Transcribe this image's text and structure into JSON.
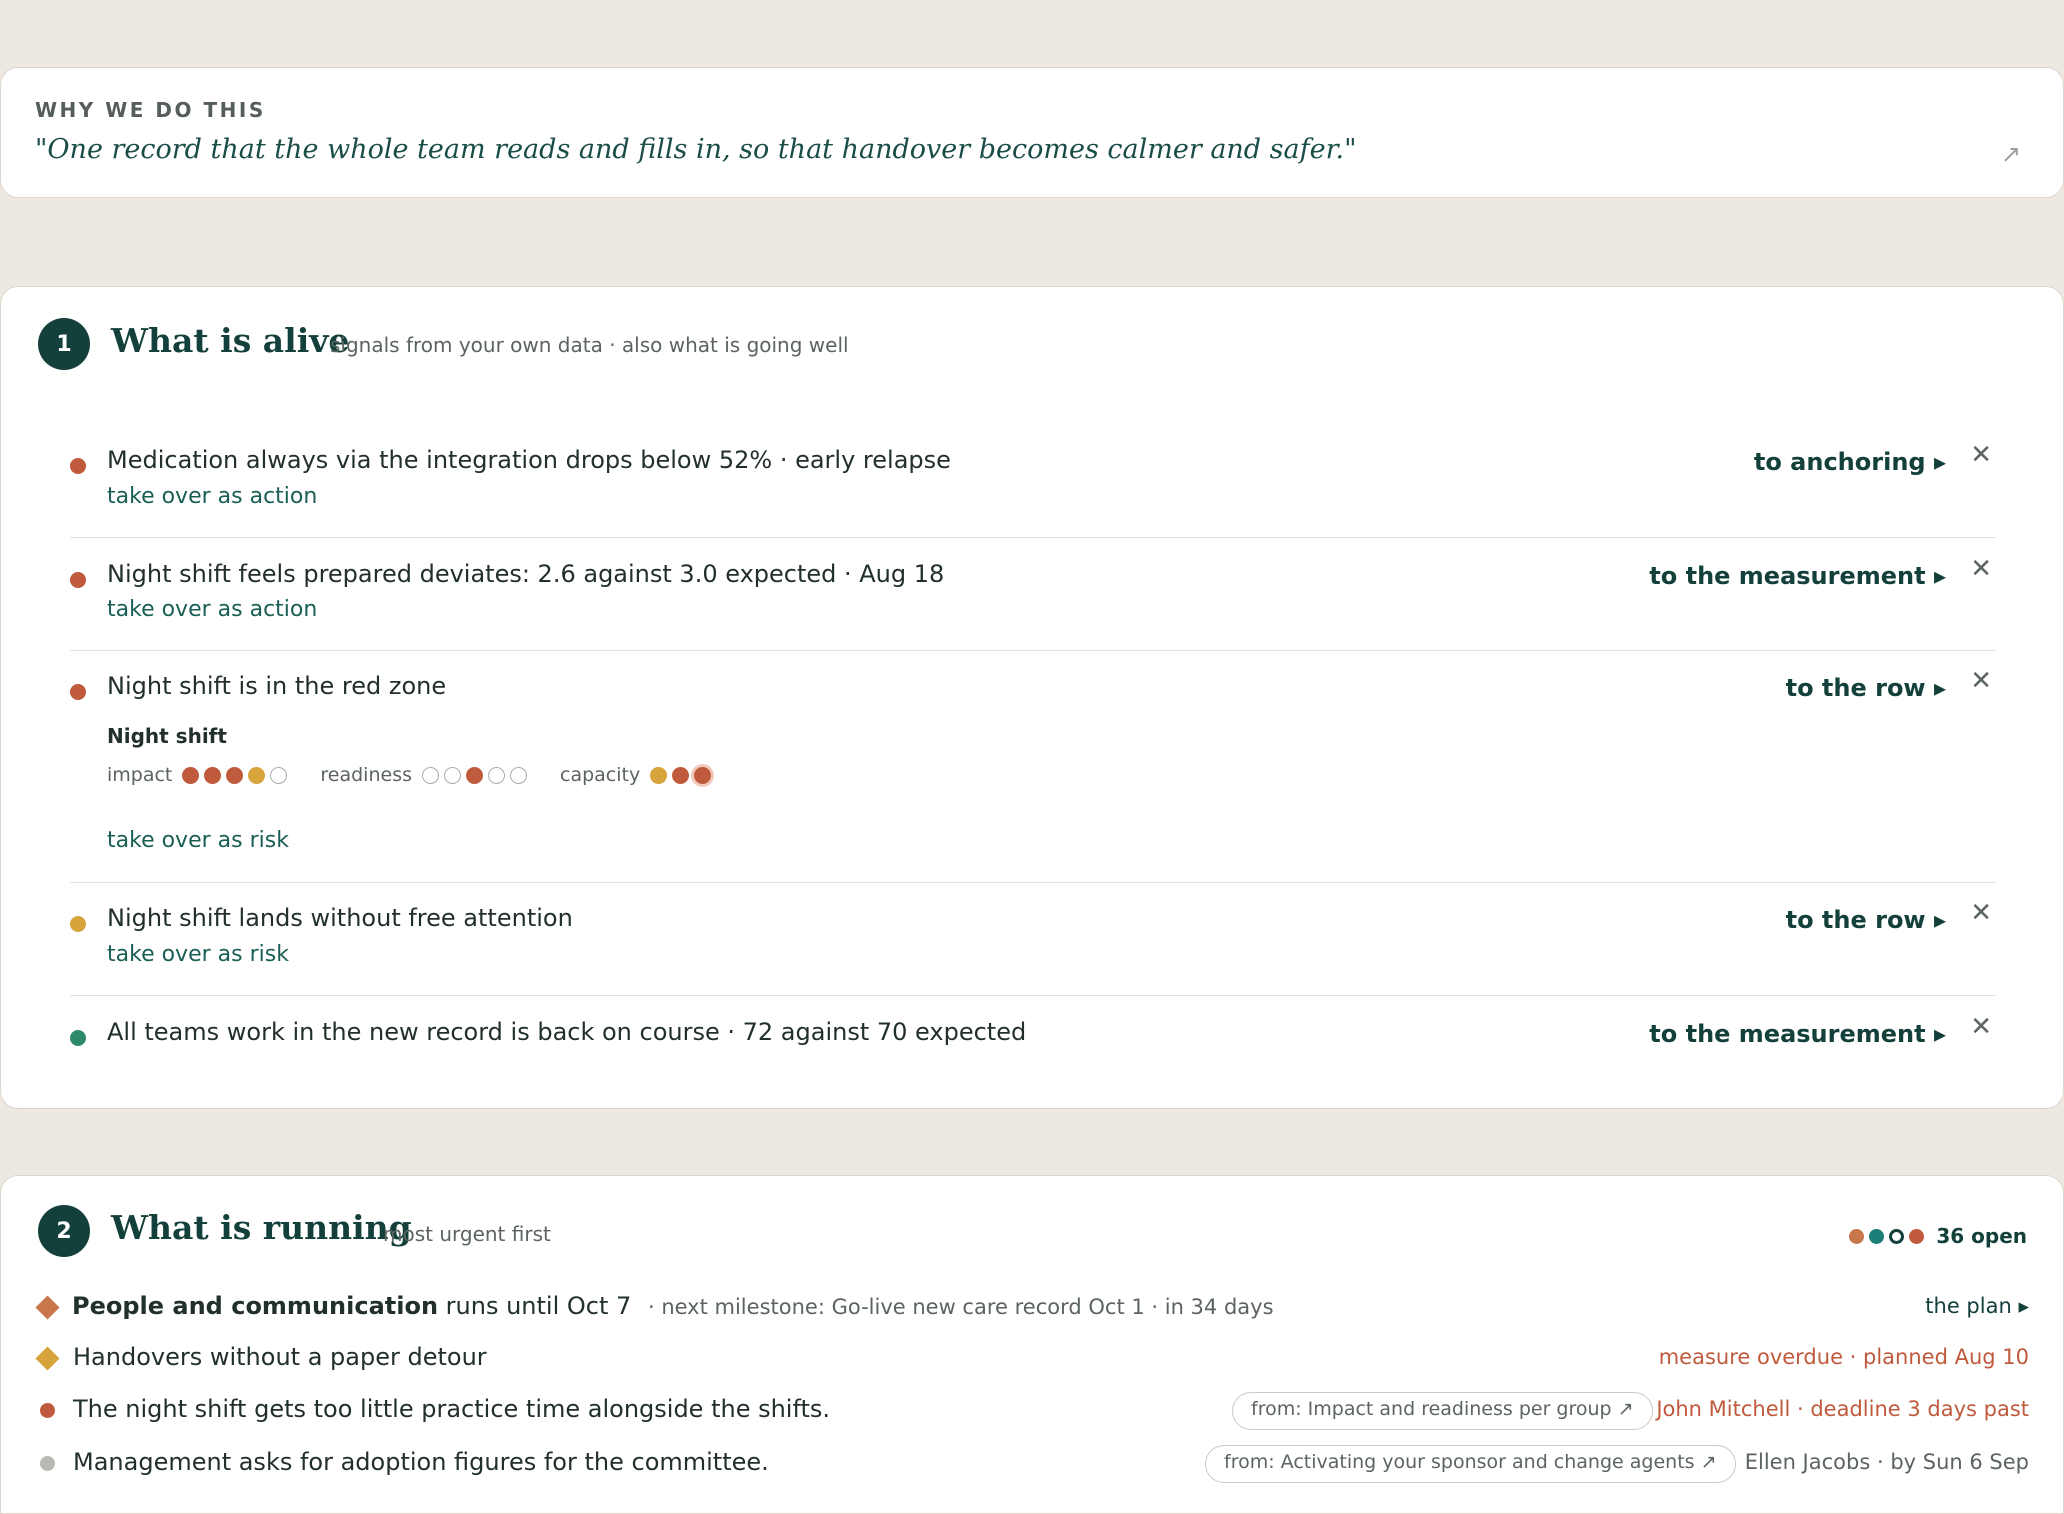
{
  "why": {
    "label": "WHY WE DO THIS",
    "quote": "\"One record that the whole team reads and fills in, so that handover becomes calmer and safer.\"",
    "arrow": "↗"
  },
  "alive": {
    "number": "1",
    "title": "What is alive",
    "subtitle": "signals from your own data · also what is going well",
    "signals": [
      {
        "text": "Medication always via the integration drops below 52% · early relapse",
        "action": "take over as action",
        "link": "to anchoring ▸",
        "status_color": "#c05a3d"
      },
      {
        "text": "Night shift feels prepared deviates: 2.6 against 3.0 expected · Aug 18",
        "action": "take over as action",
        "link": "to the measurement ▸",
        "status_color": "#c05a3d"
      },
      {
        "text": "Night shift is in the red zone",
        "action": "take over as risk",
        "link": "to the row ▸",
        "status_color": "#c05a3d",
        "group": "Night shift",
        "impact_label": "impact",
        "impact_level": 4,
        "readiness_label": "readiness",
        "readiness_level": 3,
        "capacity_label": "capacity",
        "capacity_level": 3
      },
      {
        "text": "Night shift lands without free attention",
        "action": "take over as risk",
        "link": "to the row ▸",
        "status_color": "#d7a33b"
      },
      {
        "text": "All teams work in the new record is back on course · 72 against 70 expected",
        "link": "to the measurement ▸",
        "status_color": "#2f8a6c"
      }
    ],
    "close_glyph": "✕"
  },
  "running": {
    "number": "2",
    "title": "What is running",
    "subtitle": "most urgent first",
    "open_count": "36 open",
    "rows": [
      {
        "name": "People and communication",
        "runs": " runs until Oct 7",
        "meta": " · next milestone: Go-live new care record Oct 1 · in 34 days",
        "right": "the plan ▸",
        "color": "#c8764a"
      },
      {
        "text": "Handovers without a paper detour",
        "right": "measure overdue · planned Aug 10",
        "color": "#d7a33b"
      },
      {
        "text": "The night shift gets too little practice time alongside the shifts.",
        "pill": "from: Impact and readiness per group ↗",
        "right": "John Mitchell · deadline 3 days past",
        "color": "#c05a3d"
      },
      {
        "text": "Management asks for adoption figures for the committee.",
        "pill": "from: Activating your sponsor and change agents ↗",
        "right": "Ellen Jacobs · by Sun 6 Sep",
        "color": "#b8b8b4"
      }
    ]
  },
  "colors": {
    "accent": "#14403b",
    "red": "#c05a3d",
    "amber": "#d7a33b",
    "green": "#2f8a6c",
    "teal": "#1a7f76"
  }
}
